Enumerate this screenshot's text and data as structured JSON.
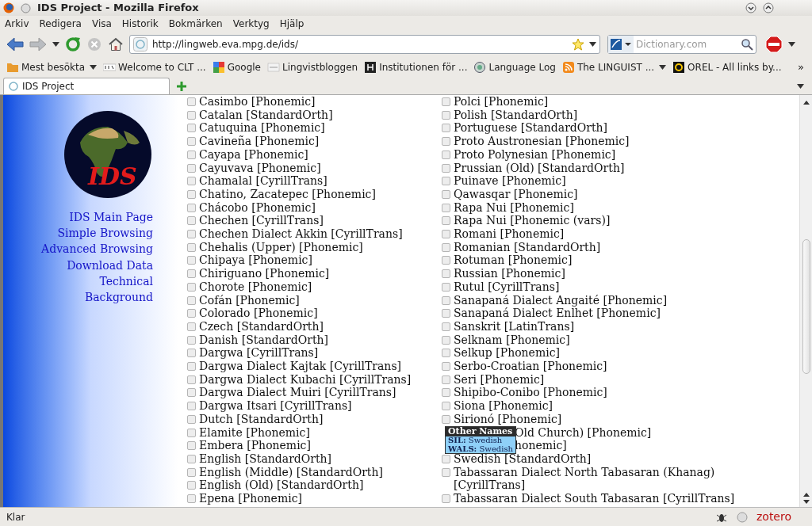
{
  "window": {
    "title": "IDS Project - Mozilla Firefox"
  },
  "menu": [
    "Arkiv",
    "Redigera",
    "Visa",
    "Historik",
    "Bokmärken",
    "Verktyg",
    "Hjälp"
  ],
  "address": {
    "value": "http://lingweb.eva.mpg.de/ids/"
  },
  "search": {
    "placeholder": "Dictionary.com"
  },
  "bookmarks": [
    {
      "label": "Mest besökta",
      "kind": "folder"
    },
    {
      "label": "Welcome to CLT ...",
      "kind": "clt"
    },
    {
      "label": "Google",
      "kind": "google"
    },
    {
      "label": "Lingvistbloggen",
      "kind": "sb"
    },
    {
      "label": "Institutionen för ...",
      "kind": "h"
    },
    {
      "label": "Language Log",
      "kind": "globe"
    },
    {
      "label": "The LINGUIST ...",
      "kind": "rss"
    },
    {
      "label": "OREL - All links by...",
      "kind": "orel"
    }
  ],
  "bookmarks_more": "»",
  "tabs": [
    {
      "label": "IDS Project",
      "selected": true
    }
  ],
  "sidebar": {
    "logo_text": "IDS",
    "links": [
      "IDS Main Page",
      "Simple Browsing",
      "Advanced Browsing",
      "Download Data",
      "Technical",
      "Background"
    ]
  },
  "columns": [
    [
      {
        "label": "Casimbo [Phonemic]",
        "checked": false
      },
      {
        "label": "Catalan [StandardOrth]",
        "checked": false
      },
      {
        "label": "Catuquina [Phonemic]",
        "checked": false
      },
      {
        "label": "Cavineña [Phonemic]",
        "checked": false
      },
      {
        "label": "Cayapa [Phonemic]",
        "checked": false
      },
      {
        "label": "Cayuvava [Phonemic]",
        "checked": false
      },
      {
        "label": "Chamalal [CyrillTrans]",
        "checked": false
      },
      {
        "label": "Chatino, Zacatepec [Phonemic]",
        "checked": false
      },
      {
        "label": "Chácobo [Phonemic]",
        "checked": false
      },
      {
        "label": "Chechen [CyrillTrans]",
        "checked": false
      },
      {
        "label": "Chechen Dialect Akkin [CyrillTrans]",
        "checked": false
      },
      {
        "label": "Chehalis (Upper) [Phonemic]",
        "checked": false
      },
      {
        "label": "Chipaya [Phonemic]",
        "checked": false
      },
      {
        "label": "Chiriguano [Phonemic]",
        "checked": false
      },
      {
        "label": "Chorote [Phonemic]",
        "checked": false
      },
      {
        "label": "Cofán [Phonemic]",
        "checked": false
      },
      {
        "label": "Colorado [Phonemic]",
        "checked": false
      },
      {
        "label": "Czech [StandardOrth]",
        "checked": false
      },
      {
        "label": "Danish [StandardOrth]",
        "checked": false
      },
      {
        "label": "Dargwa [CyrillTrans]",
        "checked": false
      },
      {
        "label": "Dargwa Dialect Kajtak [CyrillTrans]",
        "checked": false
      },
      {
        "label": "Dargwa Dialect Kubachi [CyrillTrans]",
        "checked": false
      },
      {
        "label": "Dargwa Dialect Muiri [CyrillTrans]",
        "checked": false
      },
      {
        "label": "Dargwa Itsari [CyrillTrans]",
        "checked": false
      },
      {
        "label": "Dutch [StandardOrth]",
        "checked": false
      },
      {
        "label": "Elamite [Phonemic]",
        "checked": false
      },
      {
        "label": "Embera [Phonemic]",
        "checked": false
      },
      {
        "label": "English [StandardOrth]",
        "checked": false
      },
      {
        "label": "English (Middle) [StandardOrth]",
        "checked": false
      },
      {
        "label": "English (Old) [StandardOrth]",
        "checked": false
      },
      {
        "label": "Epena [Phonemic]",
        "checked": false
      }
    ],
    [
      {
        "label": "Polci [Phonemic]",
        "checked": false
      },
      {
        "label": "Polish [StandardOrth]",
        "checked": false
      },
      {
        "label": "Portuguese [StandardOrth]",
        "checked": false
      },
      {
        "label": "Proto Austronesian [Phonemic]",
        "checked": false
      },
      {
        "label": "Proto Polynesian [Phonemic]",
        "checked": false
      },
      {
        "label": "Prussian (Old) [StandardOrth]",
        "checked": false
      },
      {
        "label": "Puinave [Phonemic]",
        "checked": false
      },
      {
        "label": "Qawasqar [Phonemic]",
        "checked": false
      },
      {
        "label": "Rapa Nui [Phonemic]",
        "checked": false
      },
      {
        "label": "Rapa Nui [Phonemic (vars)]",
        "checked": false
      },
      {
        "label": "Romani [Phonemic]",
        "checked": false
      },
      {
        "label": "Romanian [StandardOrth]",
        "checked": false
      },
      {
        "label": "Rotuman [Phonemic]",
        "checked": false
      },
      {
        "label": "Russian [Phonemic]",
        "checked": false
      },
      {
        "label": "Rutul [CyrillTrans]",
        "checked": false
      },
      {
        "label": "Sanapaná Dialect Angaité [Phonemic]",
        "checked": false
      },
      {
        "label": "Sanapaná Dialect Enlhet [Phonemic]",
        "checked": false
      },
      {
        "label": "Sanskrit [LatinTrans]",
        "checked": false
      },
      {
        "label": "Selknam [Phonemic]",
        "checked": false
      },
      {
        "label": "Selkup [Phonemic]",
        "checked": false
      },
      {
        "label": "Serbo-Croatian [Phonemic]",
        "checked": false
      },
      {
        "label": "Seri [Phonemic]",
        "checked": false
      },
      {
        "label": "Shipibo-Conibo [Phonemic]",
        "checked": false
      },
      {
        "label": "Siona [Phonemic]",
        "checked": false
      },
      {
        "label": "Sirionó [Phonemic]",
        "checked": false
      },
      {
        "label": "Old Church) [Phonemic]",
        "kind": "occluded"
      },
      {
        "label": "honemic]",
        "kind": "occluded"
      },
      {
        "label": "Swedish [StandardOrth]",
        "checked": false
      },
      {
        "label": "Tabassaran Dialect North Tabasaran (Khanag) [CyrillTrans]",
        "checked": false
      },
      {
        "label": "Tabassaran Dialect South Tabasaran [CyrillTrans]",
        "checked": false
      }
    ]
  ],
  "tooltip": {
    "title": "Other Names",
    "lines": [
      "**SIL:** Swedish",
      "**WALS:** Swedish"
    ]
  },
  "status_bar": {
    "text": "Klar",
    "addon": "zotero"
  }
}
